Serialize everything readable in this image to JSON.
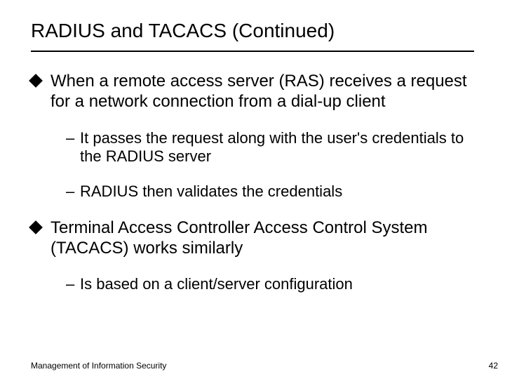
{
  "title": "RADIUS and TACACS (Continued)",
  "bullets": [
    {
      "text": "When a remote access server (RAS) receives a request for a network connection from a dial-up client",
      "sub": [
        "It passes the request along with the user's credentials to the RADIUS server",
        "RADIUS then validates the credentials"
      ]
    },
    {
      "text": "Terminal Access Controller Access Control System (TACACS) works similarly",
      "sub": [
        "Is based on a client/server configuration"
      ]
    }
  ],
  "footer": "Management of Information Security",
  "page": "42"
}
